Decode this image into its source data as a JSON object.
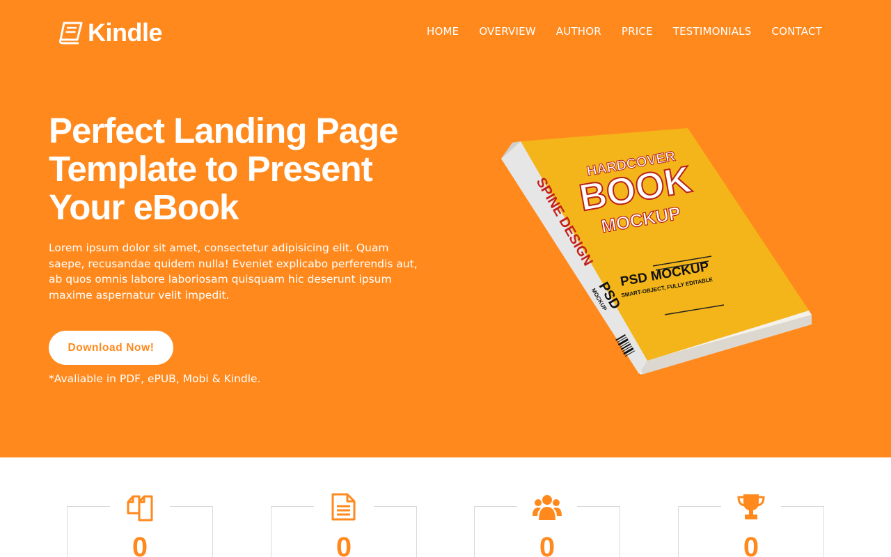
{
  "brand": {
    "name": "Kindle",
    "icon": "book-icon"
  },
  "nav": {
    "items": [
      "HOME",
      "OVERVIEW",
      "AUTHOR",
      "PRICE",
      "TESTIMONIALS",
      "CONTACT"
    ]
  },
  "hero": {
    "title": "Perfect Landing Page Template to Present Your eBook",
    "description": "Lorem ipsum dolor sit amet, consectetur adipisicing elit. Quam saepe, recusandae quidem nulla! Eveniet explicabo perferendis aut, ab quos omnis labore laboriosam quisquam hic deserunt ipsum maxime aspernatur velit impedit.",
    "button_label": "Download Now!",
    "formats_note": "*Avaliable in PDF, ePUB, Mobi & Kindle."
  },
  "book_mockup": {
    "line1": "HARDCOVER",
    "line2": "BOOK",
    "line3": "MOCKUP",
    "line4": "PSD MOCKUP",
    "line5": "SMART-OBJECT, FULLY EDITABLE",
    "spine_text": "SPINE DESIGN",
    "spine_logo_text": "PSD",
    "spine_logo_sub": "MOCKUP"
  },
  "stats": [
    {
      "icon": "copy-files-icon",
      "value": "0"
    },
    {
      "icon": "document-icon",
      "value": "0"
    },
    {
      "icon": "users-icon",
      "value": "0"
    },
    {
      "icon": "trophy-icon",
      "value": "0"
    }
  ],
  "colors": {
    "accent": "#ff891d",
    "book_cover": "#f3b519",
    "white": "#ffffff"
  }
}
